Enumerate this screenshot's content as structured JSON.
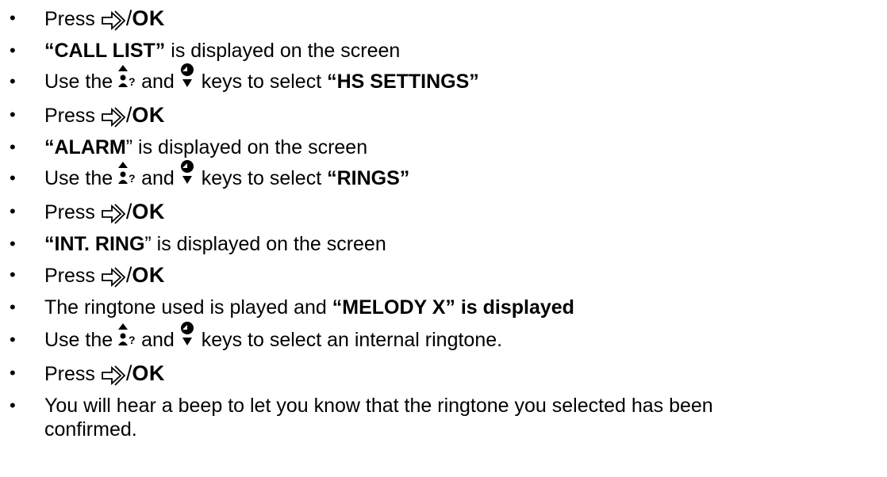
{
  "steps": [
    {
      "type": "press",
      "label": "Press",
      "ok": "OK"
    },
    {
      "type": "display",
      "strong": "“CALL LIST”",
      "rest": " is displayed on the screen"
    },
    {
      "type": "use",
      "pre": "Use the",
      "mid": "and",
      "post": "keys to select",
      "target": "“HS SETTINGS”"
    },
    {
      "type": "press",
      "label": "Press",
      "ok": "OK"
    },
    {
      "type": "display",
      "strong": "“ALARM",
      "quote": "”",
      "rest": " is displayed on the screen"
    },
    {
      "type": "use",
      "pre": "Use the",
      "mid": "and",
      "post": "keys to select",
      "target": "“RINGS”"
    },
    {
      "type": "press",
      "label": "Press",
      "ok": "OK"
    },
    {
      "type": "display",
      "strong": "“INT. RING",
      "quote": "”",
      "rest": " is displayed on the screen"
    },
    {
      "type": "press",
      "label": "Press",
      "ok": "OK"
    },
    {
      "type": "played",
      "pre": "The ringtone used is played and",
      "bold": "“MELODY X” is displayed"
    },
    {
      "type": "use",
      "pre": "Use the",
      "mid": "and",
      "post": "keys to select an internal ringtone."
    },
    {
      "type": "press",
      "label": "Press",
      "ok": "OK"
    },
    {
      "type": "confirm",
      "line1": "You will hear a beep to let you know that the ringtone you selected has been",
      "line2": "confirmed."
    }
  ],
  "bullet_char": "•",
  "icons": {
    "enter": "enter-arrow-icon",
    "up": "up-contacts-icon",
    "down": "down-volume-icon"
  }
}
